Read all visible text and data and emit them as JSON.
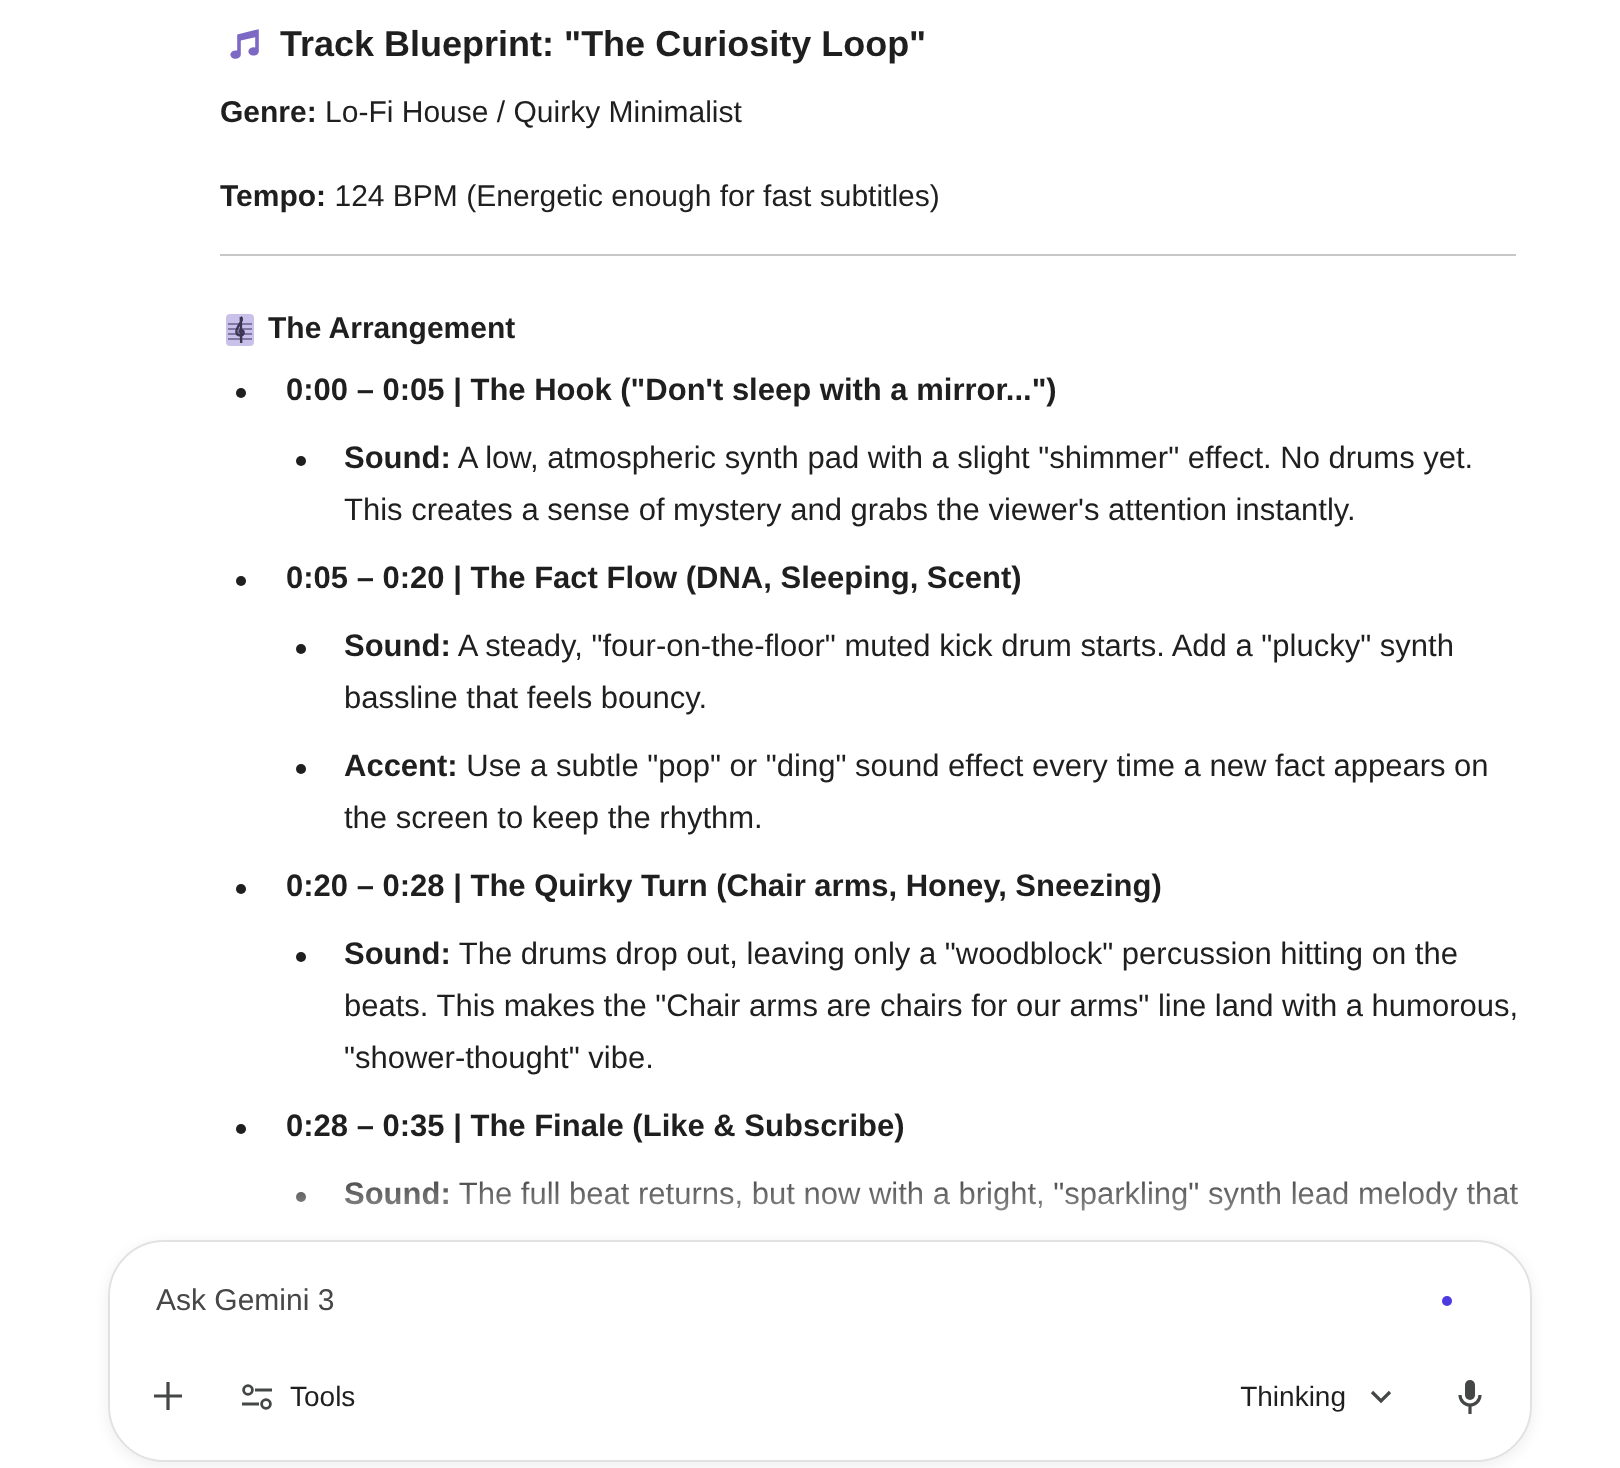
{
  "response": {
    "title": "Track Blueprint: \"The Curiosity Loop\"",
    "details": [
      "**Genre:** Lo-Fi House / Quirky Minimalist",
      "**Tempo:** 124 BPM (Energetic enough for fast subtitles)"
    ],
    "section_title": "The Arrangement",
    "sections": [
      {
        "heading": "0:00 – 0:05 | The Hook (\"Don't sleep with a mirror...\")",
        "points": [
          "**Sound:** A low, atmospheric synth pad with a slight \"shimmer\" effect. No drums yet. This creates a sense of mystery and grabs the viewer's attention instantly."
        ]
      },
      {
        "heading": "0:05 – 0:20 | The Fact Flow (DNA, Sleeping, Scent)",
        "points": [
          "**Sound:** A steady, \"four-on-the-floor\" muted kick drum starts. Add a \"plucky\" synth bassline that feels bouncy.",
          "**Accent:** Use a subtle \"pop\" or \"ding\" sound effect every time a new fact appears on the screen to keep the rhythm."
        ]
      },
      {
        "heading": "0:20 – 0:28 | The Quirky Turn (Chair arms, Honey, Sneezing)",
        "points": [
          "**Sound:** The drums drop out, leaving only a \"woodblock\" percussion hitting on the beats. This makes the \"Chair arms are chairs for our arms\" line land with a humorous, \"shower-thought\" vibe."
        ]
      },
      {
        "heading": "0:28 – 0:35 | The Finale (Like & Subscribe)",
        "points": [
          "**Sound:** The full beat returns, but now with a bright, \"sparkling\" synth lead melody that"
        ]
      }
    ]
  },
  "composer": {
    "placeholder": "Ask Gemini 3",
    "tools": "Tools",
    "mode": "Thinking"
  }
}
